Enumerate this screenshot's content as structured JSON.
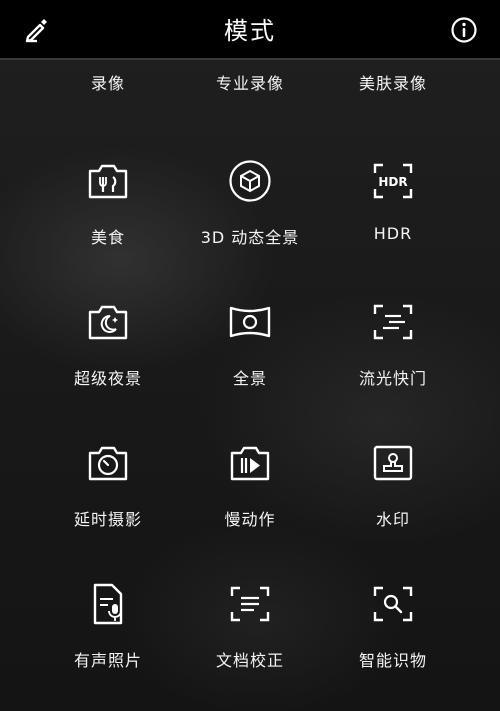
{
  "header": {
    "title": "模式",
    "edit_icon": "edit-icon",
    "info_icon": "info-icon"
  },
  "modes": [
    {
      "label": "录像",
      "icon": "video-icon"
    },
    {
      "label": "专业录像",
      "icon": "pro-video-icon"
    },
    {
      "label": "美肤录像",
      "icon": "beauty-video-icon"
    },
    {
      "label": "美食",
      "icon": "food-icon"
    },
    {
      "label": "3D 动态全景",
      "icon": "3d-panorama-icon"
    },
    {
      "label": "HDR",
      "icon": "hdr-icon",
      "icon_text": "HDR"
    },
    {
      "label": "超级夜景",
      "icon": "night-icon"
    },
    {
      "label": "全景",
      "icon": "panorama-icon"
    },
    {
      "label": "流光快门",
      "icon": "light-painting-icon"
    },
    {
      "label": "延时摄影",
      "icon": "timelapse-icon"
    },
    {
      "label": "慢动作",
      "icon": "slow-motion-icon"
    },
    {
      "label": "水印",
      "icon": "watermark-icon"
    },
    {
      "label": "有声照片",
      "icon": "audio-photo-icon"
    },
    {
      "label": "文档校正",
      "icon": "document-correction-icon"
    },
    {
      "label": "智能识物",
      "icon": "object-recognition-icon"
    }
  ]
}
